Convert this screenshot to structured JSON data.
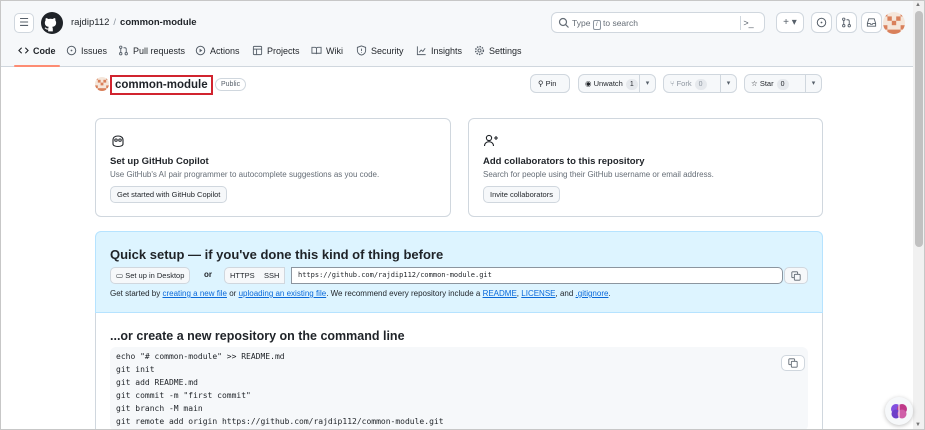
{
  "header": {
    "owner": "rajdip112",
    "separator": "/",
    "repo": "common-module",
    "search_placeholder_pre": "Type",
    "search_key": "/",
    "search_placeholder_post": "to search",
    "command_palette": ">_",
    "new_button": "+ ▾"
  },
  "tabs": [
    {
      "label": "Code",
      "icon": "code-icon"
    },
    {
      "label": "Issues",
      "icon": "issue-icon"
    },
    {
      "label": "Pull requests",
      "icon": "pull-request-icon"
    },
    {
      "label": "Actions",
      "icon": "play-icon"
    },
    {
      "label": "Projects",
      "icon": "table-icon"
    },
    {
      "label": "Wiki",
      "icon": "book-icon"
    },
    {
      "label": "Security",
      "icon": "shield-icon"
    },
    {
      "label": "Insights",
      "icon": "graph-icon"
    },
    {
      "label": "Settings",
      "icon": "gear-icon"
    }
  ],
  "repo_header": {
    "title": "common-module",
    "visibility": "Public",
    "pin_label": "Pin",
    "unwatch_label": "Unwatch",
    "watch_count": "1",
    "fork_label": "Fork",
    "fork_count": "0",
    "star_label": "Star",
    "star_count": "0"
  },
  "cards": {
    "copilot": {
      "title": "Set up GitHub Copilot",
      "description": "Use GitHub's AI pair programmer to autocomplete suggestions as you code.",
      "button": "Get started with GitHub Copilot"
    },
    "collaborators": {
      "title": "Add collaborators to this repository",
      "description": "Search for people using their GitHub username or email address.",
      "button": "Invite collaborators"
    }
  },
  "quick_setup": {
    "title": "Quick setup — if you've done this kind of thing before",
    "desktop_button": "Set up in Desktop",
    "or": "or",
    "https_label": "HTTPS",
    "ssh_label": "SSH",
    "url": "https://github.com/rajdip112/common-module.git",
    "help_pre": "Get started by",
    "help_link1": "creating a new file",
    "help_mid1": "or",
    "help_link2": "uploading an existing file",
    "help_mid2": ". We recommend every repository include a",
    "help_link3": "README",
    "help_comma": ",",
    "help_link4": "LICENSE",
    "help_and": ", and",
    "help_link5": ".gitignore",
    "help_end": "."
  },
  "command_line": {
    "title": "...or create a new repository on the command line",
    "lines": [
      "echo \"# common-module\" >> README.md",
      "git init",
      "git add README.md",
      "git commit -m \"first commit\"",
      "git branch -M main",
      "git remote add origin https://github.com/rajdip112/common-module.git"
    ]
  },
  "colors": {
    "accent_tab": "#fd8c73",
    "link": "#0969da",
    "quick_bg": "#ddf4ff",
    "highlight_border": "#d1242f"
  }
}
